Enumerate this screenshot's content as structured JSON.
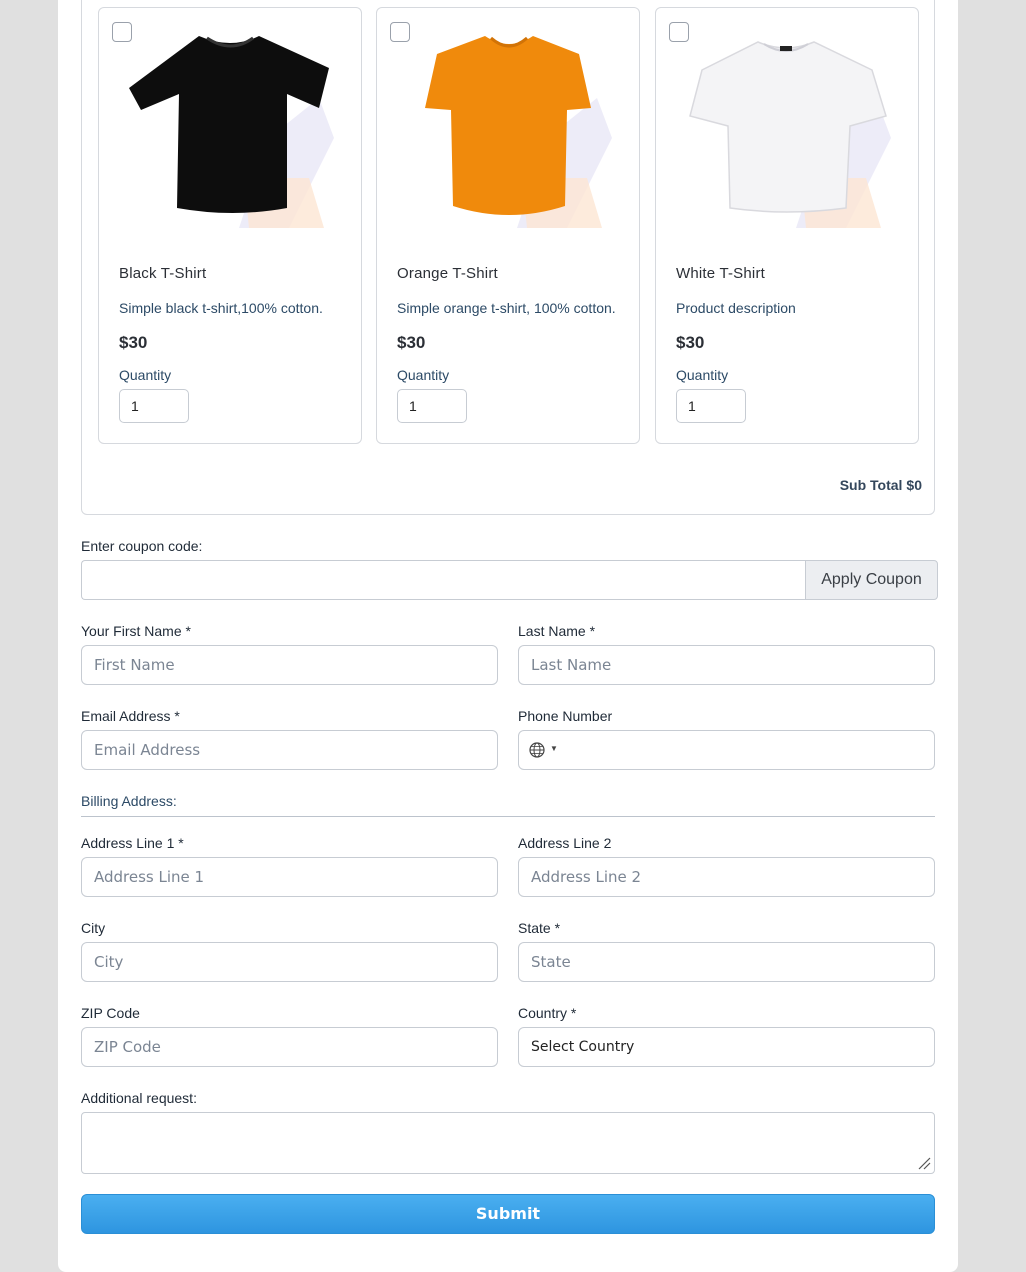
{
  "products": [
    {
      "name": "Black T-Shirt",
      "description": "Simple black t-shirt,100% cotton.",
      "price": "$30",
      "quantity_label": "Quantity",
      "quantity": "1",
      "color": "#0d0d0d"
    },
    {
      "name": "Orange T-Shirt",
      "description": "Simple orange t-shirt, 100% cotton.",
      "price": "$30",
      "quantity_label": "Quantity",
      "quantity": "1",
      "color": "#f08a0c"
    },
    {
      "name": "White T-Shirt",
      "description": "Product description",
      "price": "$30",
      "quantity_label": "Quantity",
      "quantity": "1",
      "color": "#f4f4f6"
    }
  ],
  "subtotal": {
    "label": "Sub Total",
    "value": "$0"
  },
  "coupon": {
    "label": "Enter coupon code:",
    "value": "",
    "button": "Apply Coupon"
  },
  "form": {
    "first_name": {
      "label": "Your First Name *",
      "placeholder": "First Name"
    },
    "last_name": {
      "label": "Last Name *",
      "placeholder": "Last Name"
    },
    "email": {
      "label": "Email Address *",
      "placeholder": "Email Address"
    },
    "phone": {
      "label": "Phone Number",
      "icon": "globe-icon"
    },
    "billing_title": "Billing Address:",
    "address1": {
      "label": "Address Line 1 *",
      "placeholder": "Address Line 1"
    },
    "address2": {
      "label": "Address Line 2",
      "placeholder": "Address Line 2"
    },
    "city": {
      "label": "City",
      "placeholder": "City"
    },
    "state": {
      "label": "State *",
      "placeholder": "State"
    },
    "zip": {
      "label": "ZIP Code",
      "placeholder": "ZIP Code"
    },
    "country": {
      "label": "Country *",
      "value": "Select Country"
    },
    "additional": {
      "label": "Additional request:"
    },
    "submit": "Submit"
  },
  "colors": {
    "accent": "#3aa3ea",
    "border": "#c7ccd3"
  }
}
